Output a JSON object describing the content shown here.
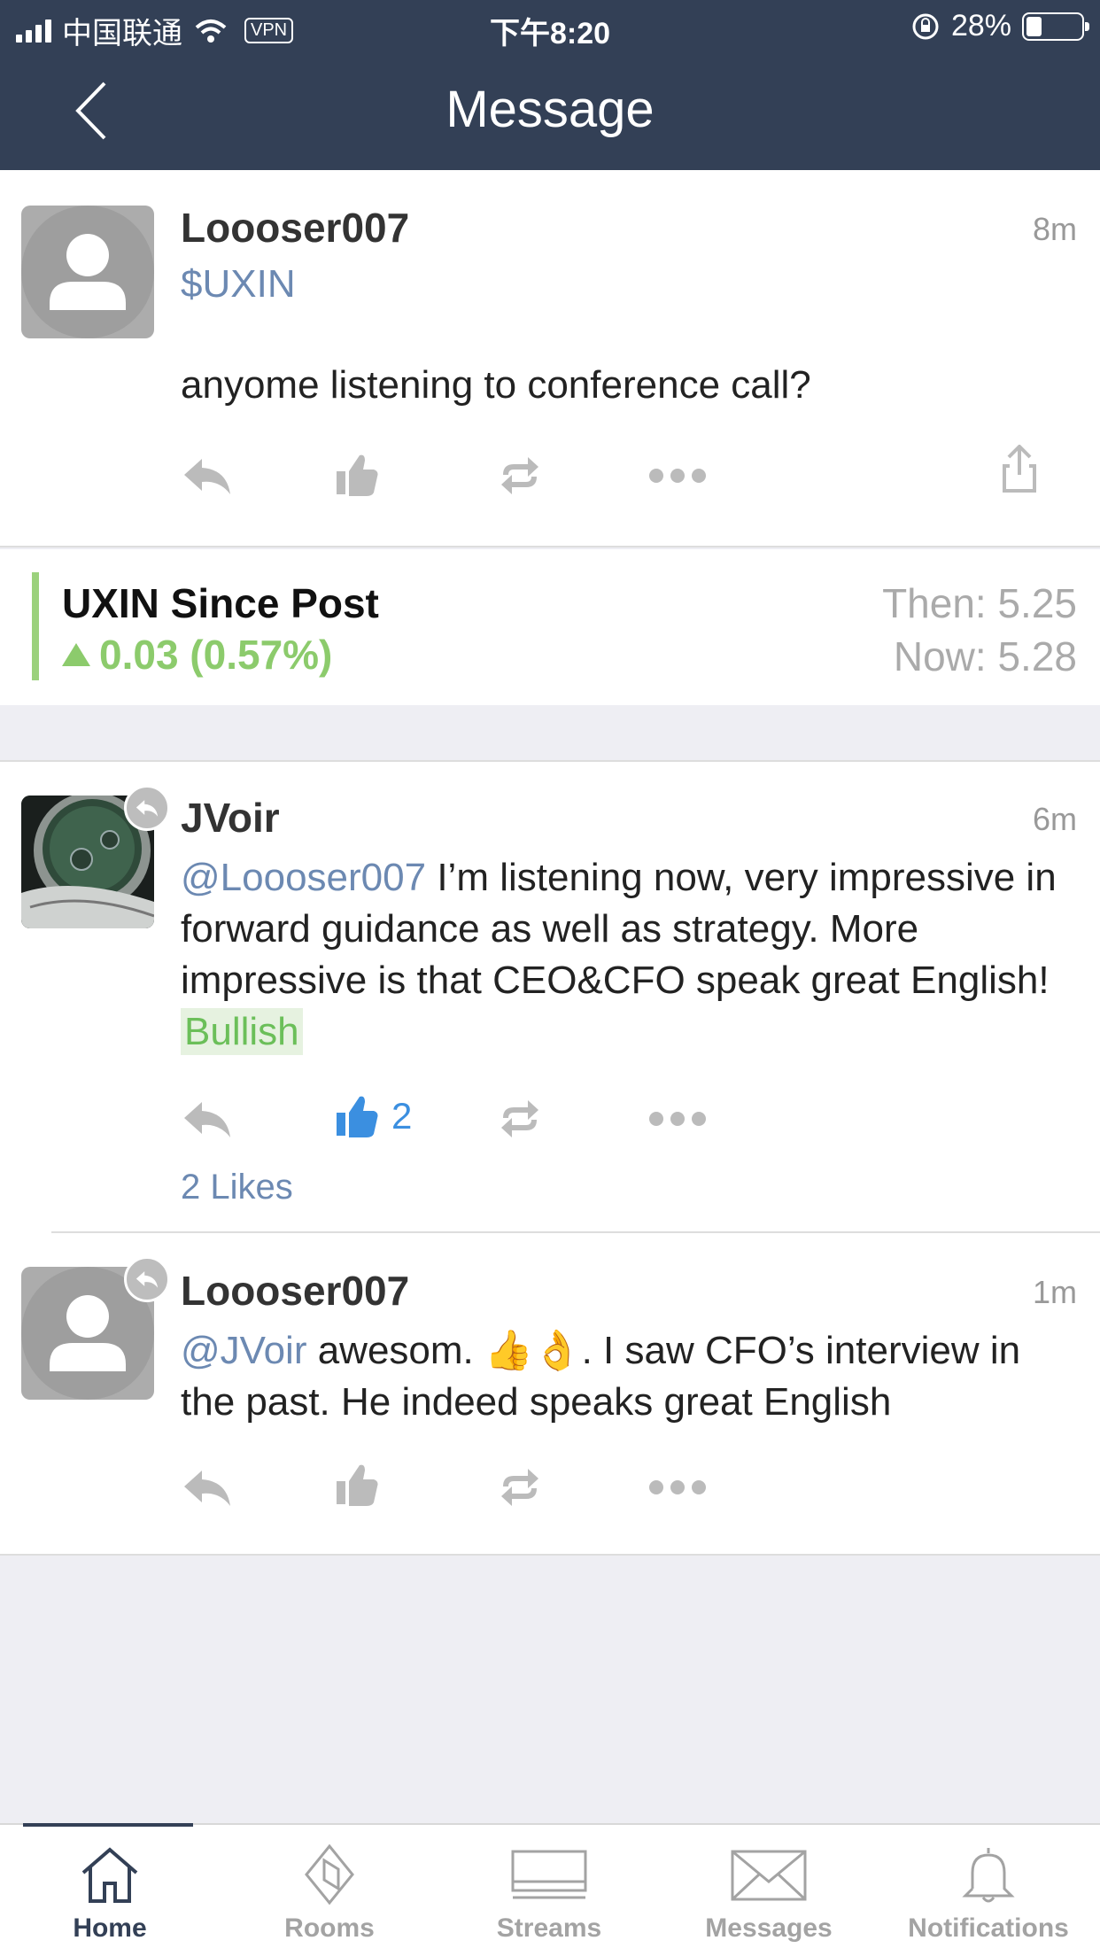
{
  "status_bar": {
    "carrier": "中国联通",
    "vpn": "VPN",
    "time": "下午8:20",
    "battery": "28%",
    "battery_level": 0.28
  },
  "nav": {
    "title": "Message"
  },
  "post": {
    "username": "Loooser007",
    "time": "8m",
    "ticker": "$UXIN",
    "text": "anyome listening to conference call?"
  },
  "since_post": {
    "title": "UXIN Since Post",
    "change": "0.03 (0.57%)",
    "then": "Then: 5.25",
    "now": "Now: 5.28"
  },
  "replies": [
    {
      "username": "JVoir",
      "time": "6m",
      "mention": "@Loooser007",
      "text": " I’m listening now, very impressive in forward guidance as well as strategy. More impressive is that CEO&CFO speak great English! ",
      "sentiment": "Bullish",
      "like_count": "2",
      "likes_label": "2 Likes"
    },
    {
      "username": "Loooser007",
      "time": "1m",
      "mention": "@JVoir",
      "text_before": " awesom. ",
      "emoji": "👍👌",
      "text_after": ". I saw CFO’s interview in the past. He indeed speaks great English"
    }
  ],
  "tabs": [
    {
      "label": "Home",
      "icon": "home-icon",
      "active": true
    },
    {
      "label": "Rooms",
      "icon": "rooms-icon"
    },
    {
      "label": "Streams",
      "icon": "streams-icon"
    },
    {
      "label": "Messages",
      "icon": "messages-icon"
    },
    {
      "label": "Notifications",
      "icon": "notifications-icon"
    }
  ],
  "colors": {
    "header": "#334056",
    "link": "#6C89B2",
    "positive": "#8CCB6C",
    "like_active": "#3B8FE0"
  }
}
